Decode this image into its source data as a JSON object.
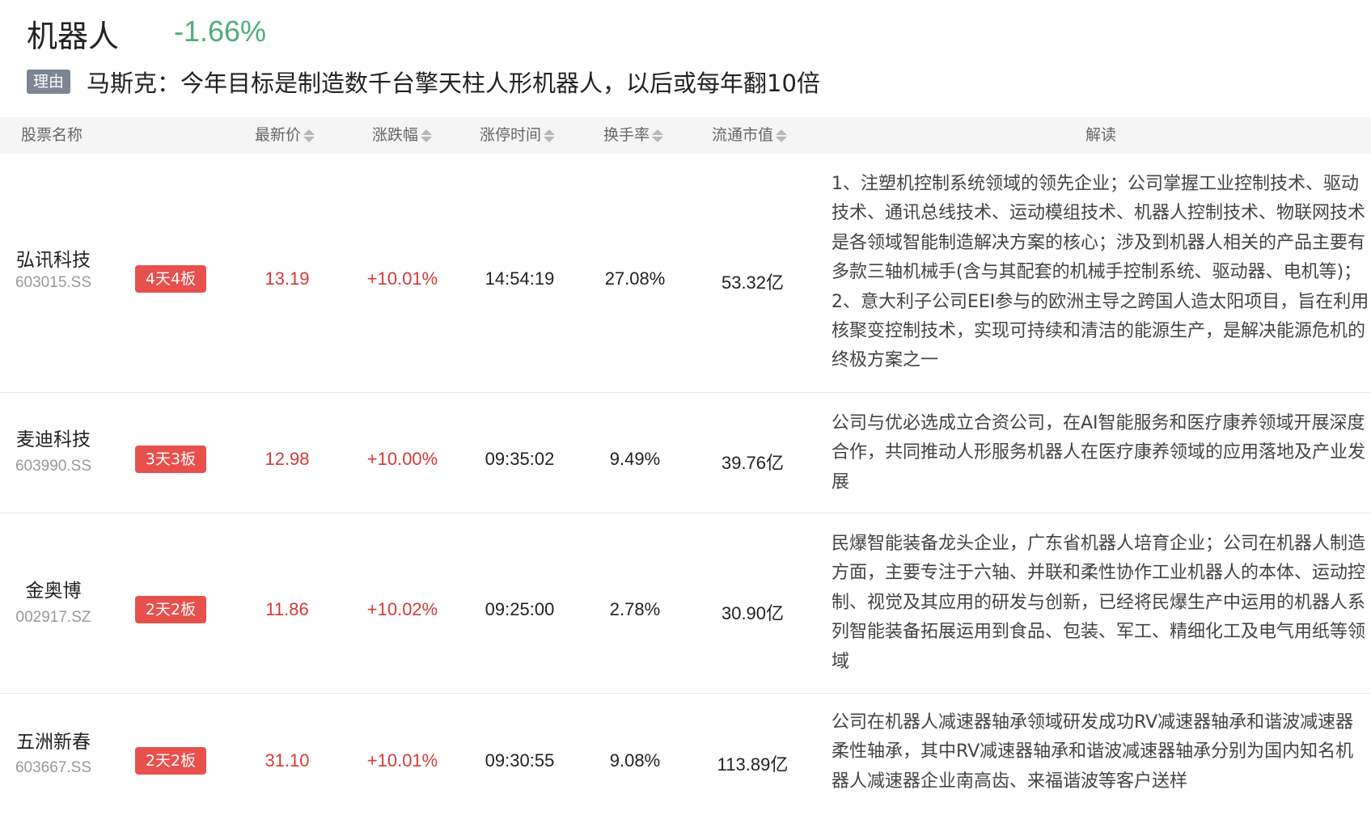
{
  "sector": {
    "name": "机器人",
    "change": "-1.66%"
  },
  "reason": {
    "tag": "理由",
    "text": "马斯克：今年目标是制造数千台擎天柱人形机器人，以后或每年翻10倍"
  },
  "table": {
    "headers": {
      "name": "股票名称",
      "price": "最新价",
      "change": "涨跌幅",
      "limit_time": "涨停时间",
      "turnover": "换手率",
      "market_cap": "流通市值",
      "analysis": "解读"
    },
    "rows": [
      {
        "name": "弘讯科技",
        "code": "603015.SS",
        "badge": "4天4板",
        "price": "13.19",
        "change": "+10.01%",
        "limit_time": "14:54:19",
        "turnover": "27.08%",
        "market_cap": "53.32亿",
        "analysis": "1、注塑机控制系统领域的领先企业；公司掌握工业控制技术、驱动技术、通讯总线技术、运动模组技术、机器人控制技术、物联网技术是各领域智能制造解决方案的核心；涉及到机器人相关的产品主要有多款三轴机械手(含与其配套的机械手控制系统、驱动器、电机等)； 2、意大利子公司EEI参与的欧洲主导之跨国人造太阳项目，旨在利用核聚变控制技术，实现可持续和清洁的能源生产，是解决能源危机的终极方案之一"
      },
      {
        "name": "麦迪科技",
        "code": "603990.SS",
        "badge": "3天3板",
        "price": "12.98",
        "change": "+10.00%",
        "limit_time": "09:35:02",
        "turnover": "9.49%",
        "market_cap": "39.76亿",
        "analysis": "公司与优必选成立合资公司，在AI智能服务和医疗康养领域开展深度合作，共同推动人形服务机器人在医疗康养领域的应用落地及产业发展"
      },
      {
        "name": "金奥博",
        "code": "002917.SZ",
        "badge": "2天2板",
        "price": "11.86",
        "change": "+10.02%",
        "limit_time": "09:25:00",
        "turnover": "2.78%",
        "market_cap": "30.90亿",
        "analysis": "民爆智能装备龙头企业，广东省机器人培育企业；公司在机器人制造方面，主要专注于六轴、并联和柔性协作工业机器人的本体、运动控制、视觉及其应用的研发与创新，已经将民爆生产中运用的机器人系列智能装备拓展运用到食品、包装、军工、精细化工及电气用纸等领域"
      },
      {
        "name": "五洲新春",
        "code": "603667.SS",
        "badge": "2天2板",
        "price": "31.10",
        "change": "+10.01%",
        "limit_time": "09:30:55",
        "turnover": "9.08%",
        "market_cap": "113.89亿",
        "analysis": "公司在机器人减速器轴承领域研发成功RV减速器轴承和谐波减速器柔性轴承，其中RV减速器轴承和谐波减速器轴承分别为国内知名机器人减速器企业南高齿、来福谐波等客户送样"
      }
    ]
  }
}
